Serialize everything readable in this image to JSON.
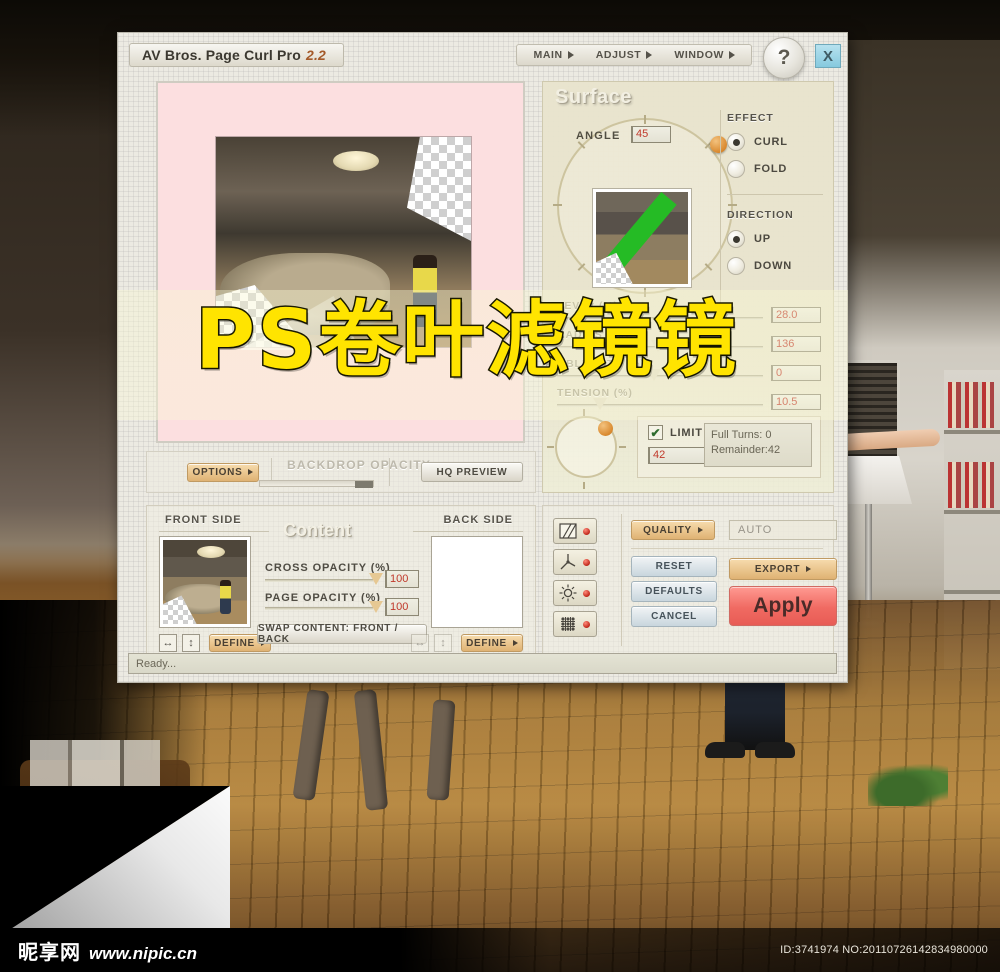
{
  "window": {
    "title": "AV Bros. Page Curl Pro",
    "version": "2.2",
    "help_label": "?",
    "close_label": "X",
    "menus": [
      {
        "label": "MAIN"
      },
      {
        "label": "ADJUST"
      },
      {
        "label": "WINDOW"
      }
    ],
    "status": "Ready..."
  },
  "preview": {
    "options_label": "OPTIONS",
    "backdrop_label": "BACKDROP OPACITY",
    "hq_preview_label": "HQ PREVIEW"
  },
  "surface": {
    "title": "Surface",
    "angle_label": "ANGLE",
    "angle_value": "45",
    "effect_label": "EFFECT",
    "effect_options": [
      {
        "label": "CURL",
        "selected": true
      },
      {
        "label": "FOLD",
        "selected": false
      }
    ],
    "direction_label": "DIRECTION",
    "direction_options": [
      {
        "label": "UP",
        "selected": true
      },
      {
        "label": "DOWN",
        "selected": false
      }
    ],
    "sliders": [
      {
        "label": "LEVEL (%)",
        "value": "28.0",
        "pct": 26
      },
      {
        "label": "RADIUS (px)",
        "value": "136",
        "pct": 52
      },
      {
        "label": "OBLIQUITY (%)",
        "value": "0",
        "pct": 50
      },
      {
        "label": "TENSION (%)",
        "value": "10.5",
        "pct": 22
      }
    ],
    "limit_label": "LIMIT (°)",
    "limit_checked": "✔",
    "limit_value": "42",
    "full_turns": "Full Turns:  0",
    "remainder": "Remainder:42"
  },
  "content": {
    "title": "Content",
    "front_side_label": "FRONT SIDE",
    "back_side_label": "BACK SIDE",
    "cross_opacity_label": "CROSS OPACITY (%)",
    "cross_opacity_value": "100",
    "page_opacity_label": "PAGE OPACITY (%)",
    "page_opacity_value": "100",
    "swap_label": "SWAP CONTENT: FRONT / BACK",
    "define_label": "DEFINE",
    "flip_h_icon": "↔",
    "flip_v_icon": "↕"
  },
  "controls": {
    "quality_label": "QUALITY",
    "quality_value": "AUTO",
    "reset_label": "RESET",
    "defaults_label": "DEFAULTS",
    "cancel_label": "CANCEL",
    "export_label": "EXPORT",
    "apply_label": "Apply",
    "toggles": [
      {
        "name": "shading-icon"
      },
      {
        "name": "axes-icon"
      },
      {
        "name": "light-icon"
      },
      {
        "name": "mesh-icon"
      }
    ]
  },
  "overlay": {
    "caption": "PS卷叶滤镜镜"
  },
  "watermark": {
    "site_name": "昵享网",
    "url": "www.nipic.cn",
    "id_text": "ID:3741974 NO:20110726142834980000"
  },
  "colors": {
    "accent_apply": "#f06a62",
    "accent_tan": "#dfb273",
    "value_text": "#c0392b",
    "overlay_text": "#ffe400"
  }
}
